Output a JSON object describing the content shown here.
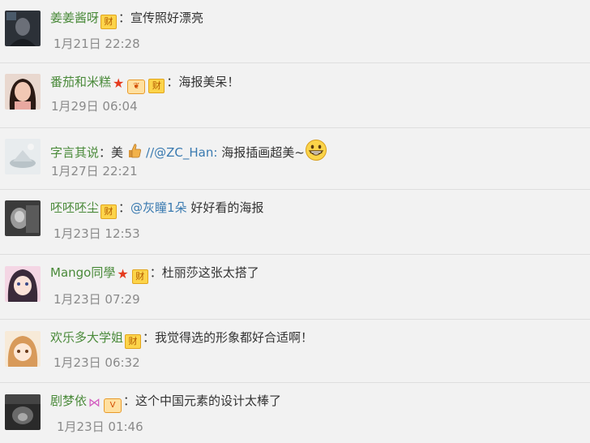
{
  "comments": [
    {
      "name": "姜姜酱呀",
      "badge_cai": "财",
      "colon": "：",
      "text": "宣传照好漂亮",
      "time": "1月21日 22:28"
    },
    {
      "name": "番茄和米糕",
      "badge_cai": "财",
      "colon": "：",
      "text": "海报美呆！",
      "time": "1月29日 06:04"
    },
    {
      "name": "字言其说",
      "colon": "：",
      "text_before": "美",
      "repost": "//@ZC_Han:",
      "text": " 海报插画超美~",
      "time": "1月27日 22:21"
    },
    {
      "name": "呸呸呸尘",
      "badge_cai": "财",
      "colon": "：",
      "mention": "@灰瞳1朵",
      "text": " 好好看的海报",
      "time": "1月23日 12:53"
    },
    {
      "name": "Mango同學",
      "badge_cai": "财",
      "colon": "：",
      "text": "杜丽莎这张太搭了",
      "time": "1月23日 07:29"
    },
    {
      "name": "欢乐多大学姐",
      "badge_cai": "财",
      "colon": "：",
      "text": "我觉得选的形象都好合适啊！",
      "time": "1月23日 06:32"
    },
    {
      "name": "剧梦依",
      "colon": "：",
      "text": "这个中国元素的设计太棒了",
      "time": "1月23日 01:46"
    }
  ],
  "icons": {
    "avatar_1": "avatar-dark-portrait",
    "avatar_2": "avatar-girl-portrait",
    "avatar_3": "avatar-light-scene",
    "avatar_4": "avatar-bw-photo",
    "avatar_5": "avatar-anime-girl",
    "avatar_6": "avatar-cartoon-girl",
    "avatar_7": "avatar-dark-photo",
    "star": "red-star-icon",
    "vip": "vip-member-icon",
    "bow": "pink-bow-icon",
    "thumb": "thumbs-up-emoji",
    "grin": "grinning-emoji"
  },
  "colors": {
    "name": "#4a8a3a",
    "mention": "#3a7ab0",
    "time": "#8a8a8a",
    "badge_bg": "#fcd44a",
    "star": "#e53b1f"
  }
}
